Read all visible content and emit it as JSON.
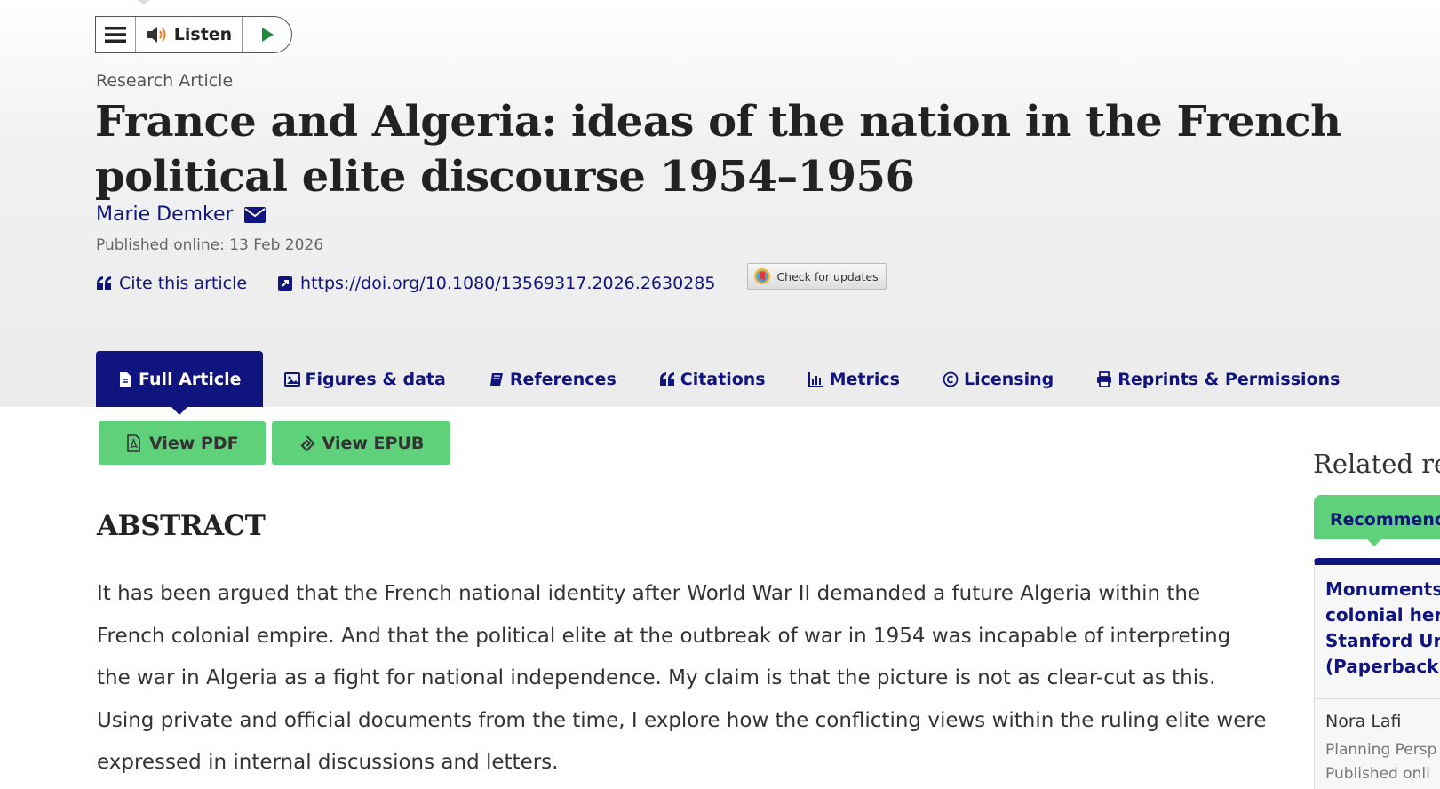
{
  "toolbar": {
    "listen_label": "Listen"
  },
  "article": {
    "type": "Research Article",
    "title": "France and Algeria: ideas of the nation in the French political elite discourse 1954–1956",
    "author": "Marie Demker",
    "published": "Published online: 13 Feb 2026",
    "cite_label": "Cite this article",
    "doi": "https://doi.org/10.1080/13569317.2026.2630285",
    "check_updates": "Check for updates"
  },
  "tabs": [
    {
      "label": "Full Article",
      "icon": "file-icon",
      "active": true
    },
    {
      "label": "Figures & data",
      "icon": "image-icon"
    },
    {
      "label": "References",
      "icon": "book-icon"
    },
    {
      "label": "Citations",
      "icon": "quote-icon"
    },
    {
      "label": "Metrics",
      "icon": "bar-chart-icon"
    },
    {
      "label": "Licensing",
      "icon": "copyright-icon"
    },
    {
      "label": "Reprints & Permissions",
      "icon": "print-icon"
    }
  ],
  "actions": {
    "view_pdf": "View PDF",
    "view_epub": "View EPUB"
  },
  "abstract": {
    "heading": "ABSTRACT",
    "text": "It has been argued that the French national identity after World War II demanded a future Algeria within the French colonial empire. And that the political elite at the outbreak of war in 1954 was incapable of interpreting the war in Algeria as a fight for national independence. My claim is that the picture is not as clear-cut as this. Using private and official documents from the time, I explore how the conflicting views within the ruling elite were expressed in internal discussions and letters."
  },
  "sidebar": {
    "heading": "Related re",
    "tab_label": "Recommenc",
    "card": {
      "title": "Monuments\ncolonial her\nStanford Un\n(Paperback)",
      "author": "Nora Lafi",
      "journal": "Planning Persp",
      "published": "Published onli"
    }
  },
  "colors": {
    "brand_navy": "#10147e",
    "action_green": "#5ed17a"
  }
}
